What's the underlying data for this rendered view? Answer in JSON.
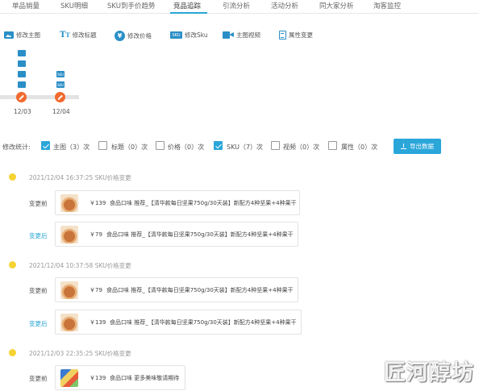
{
  "tabs": [
    {
      "label": "单品销量"
    },
    {
      "label": "SKU明细"
    },
    {
      "label": "SKU到手价趋势"
    },
    {
      "label": "竞品追踪"
    },
    {
      "label": "引流分析"
    },
    {
      "label": "活动分析"
    },
    {
      "label": "同大家分析"
    },
    {
      "label": "淘客监控"
    }
  ],
  "legend": [
    {
      "label": "修改主图",
      "icon": "image-icon"
    },
    {
      "label": "修改标题",
      "icon": "title-icon"
    },
    {
      "label": "修改价格",
      "icon": "price-icon"
    },
    {
      "label": "修改Sku",
      "icon": "sku-icon"
    },
    {
      "label": "主图视频",
      "icon": "video-icon"
    },
    {
      "label": "属性变更",
      "icon": "attribute-icon"
    }
  ],
  "timeline": {
    "dates": [
      "12/03",
      "12/04"
    ],
    "sku_icon_text": "SKU"
  },
  "stats": {
    "label": "修改统计:",
    "items": [
      {
        "text": "主图（3）次",
        "checked": true
      },
      {
        "text": "标题（0）次",
        "checked": false
      },
      {
        "text": "价格（0）次",
        "checked": false
      },
      {
        "text": "SKU（7）次",
        "checked": true
      },
      {
        "text": "视频（0）次",
        "checked": false
      },
      {
        "text": "属性（0）次",
        "checked": false
      }
    ],
    "export_label": "导出数据"
  },
  "records": [
    {
      "time": "2021/12/04 16:37:25 SKU价格变更",
      "rows": [
        {
          "label": "变更前",
          "price": "￥139",
          "title": "食品口味 推荐_【清华款每日坚果750g/30天装】新配方4种坚果+4种果干"
        },
        {
          "label": "变更后",
          "price": "￥79",
          "title": "食品口味 推荐_【清华款每日坚果750g/30天装】新配方4种坚果+4种果干"
        }
      ]
    },
    {
      "time": "2021/12/04 10:37:58 SKU价格变更",
      "rows": [
        {
          "label": "变更前",
          "price": "￥79",
          "title": "食品口味 推荐_【清华款每日坚果750g/30天装】新配方4种坚果+4种果干"
        },
        {
          "label": "变更后",
          "price": "￥139",
          "title": "食品口味 推荐_【清华款每日坚果750g/30天装】新配方4种坚果+4种果干"
        }
      ]
    },
    {
      "time": "2021/12/03 22:35:25 SKU价格变更",
      "rows": [
        {
          "label": "变更前",
          "price": "￥139",
          "title": "食品口味 更多美味敬请期待"
        }
      ]
    }
  ],
  "watermark": "匠河醇坊",
  "colors": {
    "accent": "#2aa6d9",
    "icon_blue": "#2a8fc7",
    "marker": "#f26a2e",
    "dot": "#f5d332"
  }
}
